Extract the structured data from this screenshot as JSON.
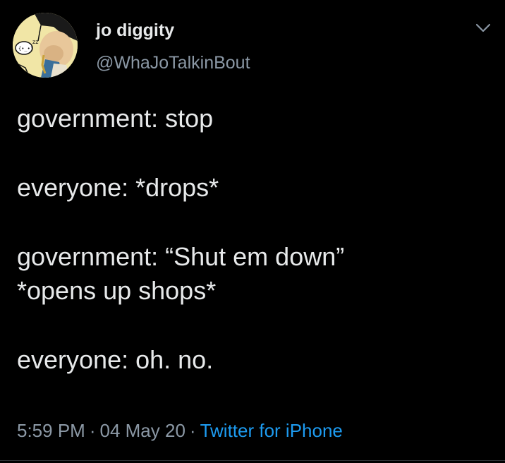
{
  "user": {
    "display_name": "jo diggity",
    "handle": "@WhaJoTalkinBout"
  },
  "avatar": {
    "icon": "cartoon-avatar-icon"
  },
  "tweet": {
    "lines": [
      "government: stop",
      "everyone: *drops*",
      "government: “Shut em down”",
      "*opens up shops*",
      "everyone: oh. no."
    ]
  },
  "meta": {
    "time": "5:59 PM",
    "date": "04 May 20",
    "source": "Twitter for iPhone",
    "separator": "·"
  },
  "colors": {
    "background": "#000000",
    "text": "#e7e9ea",
    "secondary": "#8b98a5",
    "link": "#1d9bf0"
  }
}
